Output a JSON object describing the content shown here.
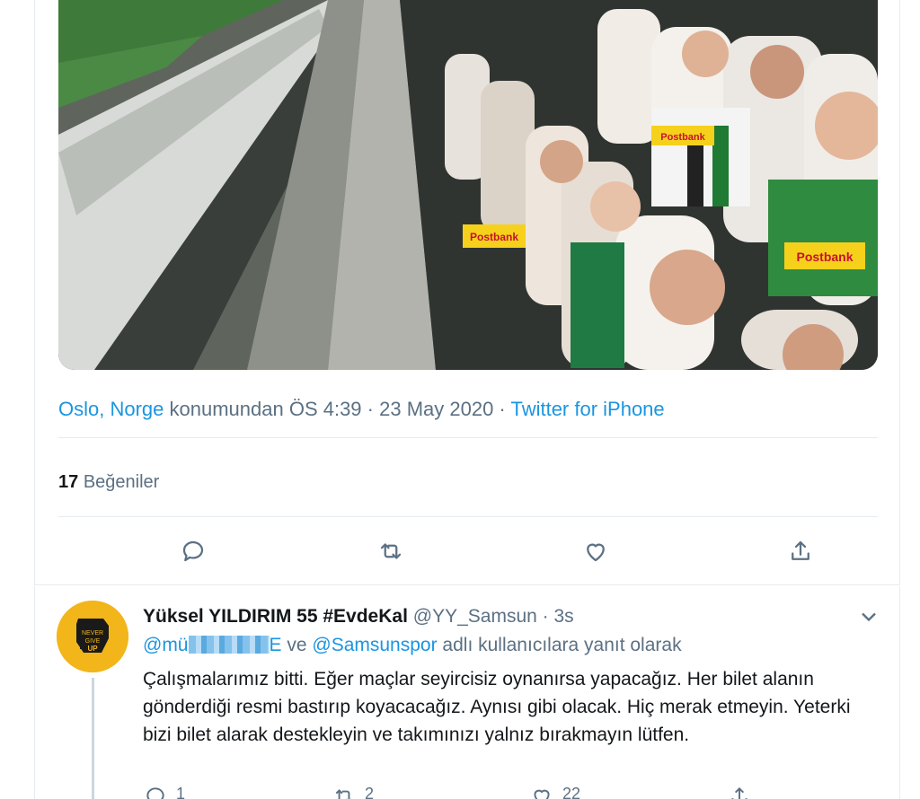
{
  "tweet": {
    "location_link": "Oslo, Norge",
    "location_suffix": " konumundan ",
    "time": "ÖS 4:39",
    "separator": " · ",
    "date": "23 May 2020",
    "source": "Twitter for iPhone",
    "likes_count": "17",
    "likes_label": "Beğeniler",
    "photo_alt": "Stadium stands filled with cardboard fan cutouts",
    "photo_signs": [
      "Postbank",
      "Postbank",
      "Postbank"
    ],
    "icons": [
      "reply-icon",
      "retweet-icon",
      "like-icon",
      "share-icon"
    ]
  },
  "reply": {
    "name": "Yüksel YILDIRIM 55 #EvdeKal",
    "handle": "@YY_Samsun",
    "dot": " · ",
    "time": "3s",
    "avatar_text": [
      "NEVER",
      "GIVE",
      "UP"
    ],
    "mention_1": "@mü",
    "mention_1_tail": "E",
    "conj": " ve ",
    "mention_2": "@Samsunspor",
    "reply_suffix": " adlı kullanıcılara yanıt olarak",
    "text": "Çalışmalarımız bitti. Eğer maçlar seyircisiz oynanırsa yapacağız. Her bilet alanın gönderdiği resmi bastırıp koyacacağız. Aynısı gibi olacak. Hiç merak etmeyin. Yeterki bizi bilet alarak destekleyin ve takımınızı yalnız bırakmayın lütfen.",
    "reply_count": "1",
    "retweet_count": "2",
    "like_count": "22"
  },
  "colors": {
    "link": "#1b95e0",
    "muted": "#5b7083",
    "border": "#e6ecf0",
    "avatar": "#f2b51a"
  }
}
